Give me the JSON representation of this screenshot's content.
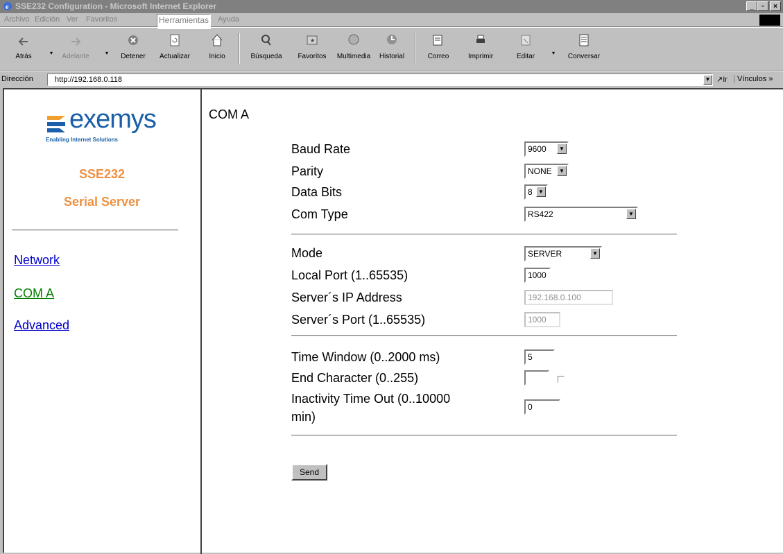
{
  "window": {
    "title": "SSE232 Configuration - Microsoft Internet Explorer",
    "buttons": [
      "_",
      "Έ",
      "x"
    ]
  },
  "menu": [
    "Archivo",
    "Edición",
    "Ver",
    "Favoritos",
    "Herramientas",
    "Ayuda"
  ],
  "toolbar": {
    "back": "Atrás",
    "forward": "Adelante",
    "stop": "Detener",
    "refresh": "Actualizar",
    "home": "Inicio",
    "search": "Búsqueda",
    "favorites": "Favoritos",
    "media": "Multimedia",
    "history": "Historial",
    "mail": "Correo",
    "print": "Imprimir",
    "edit": "Editar",
    "discuss": "Conversar"
  },
  "address": {
    "label": "Dirección",
    "url": "http://192.168.0.118",
    "go": "Ir",
    "links": "Vínculos »"
  },
  "sidebar": {
    "logo_text": "exemys",
    "logo_tagline": "Enabling Internet Solutions",
    "product": "SSE232",
    "subtitle": "Serial Server",
    "links": [
      "Network",
      "COM A",
      "Advanced"
    ]
  },
  "form": {
    "title": "COM A",
    "baud_rate": {
      "label": "Baud Rate",
      "value": "9600"
    },
    "parity": {
      "label": "Parity",
      "value": "NONE"
    },
    "data_bits": {
      "label": "Data Bits",
      "value": "8"
    },
    "com_type": {
      "label": "Com Type",
      "value": "RS422"
    },
    "mode": {
      "label": "Mode",
      "value": "SERVER"
    },
    "local_port": {
      "label": "Local Port (1..65535)",
      "value": "1000"
    },
    "server_ip": {
      "label": "Server´s IP Address",
      "value": "192.168.0.100"
    },
    "server_port": {
      "label": "Server´s Port (1..65535)",
      "value": "1000"
    },
    "time_window": {
      "label": "Time Window (0..2000 ms)",
      "value": "5"
    },
    "end_char": {
      "label": "End Character (0..255)",
      "value": ""
    },
    "inactivity": {
      "label_line1": "Inactivity Time Out (0..10000",
      "label_line2": "min)",
      "value": "0"
    },
    "send": "Send"
  }
}
